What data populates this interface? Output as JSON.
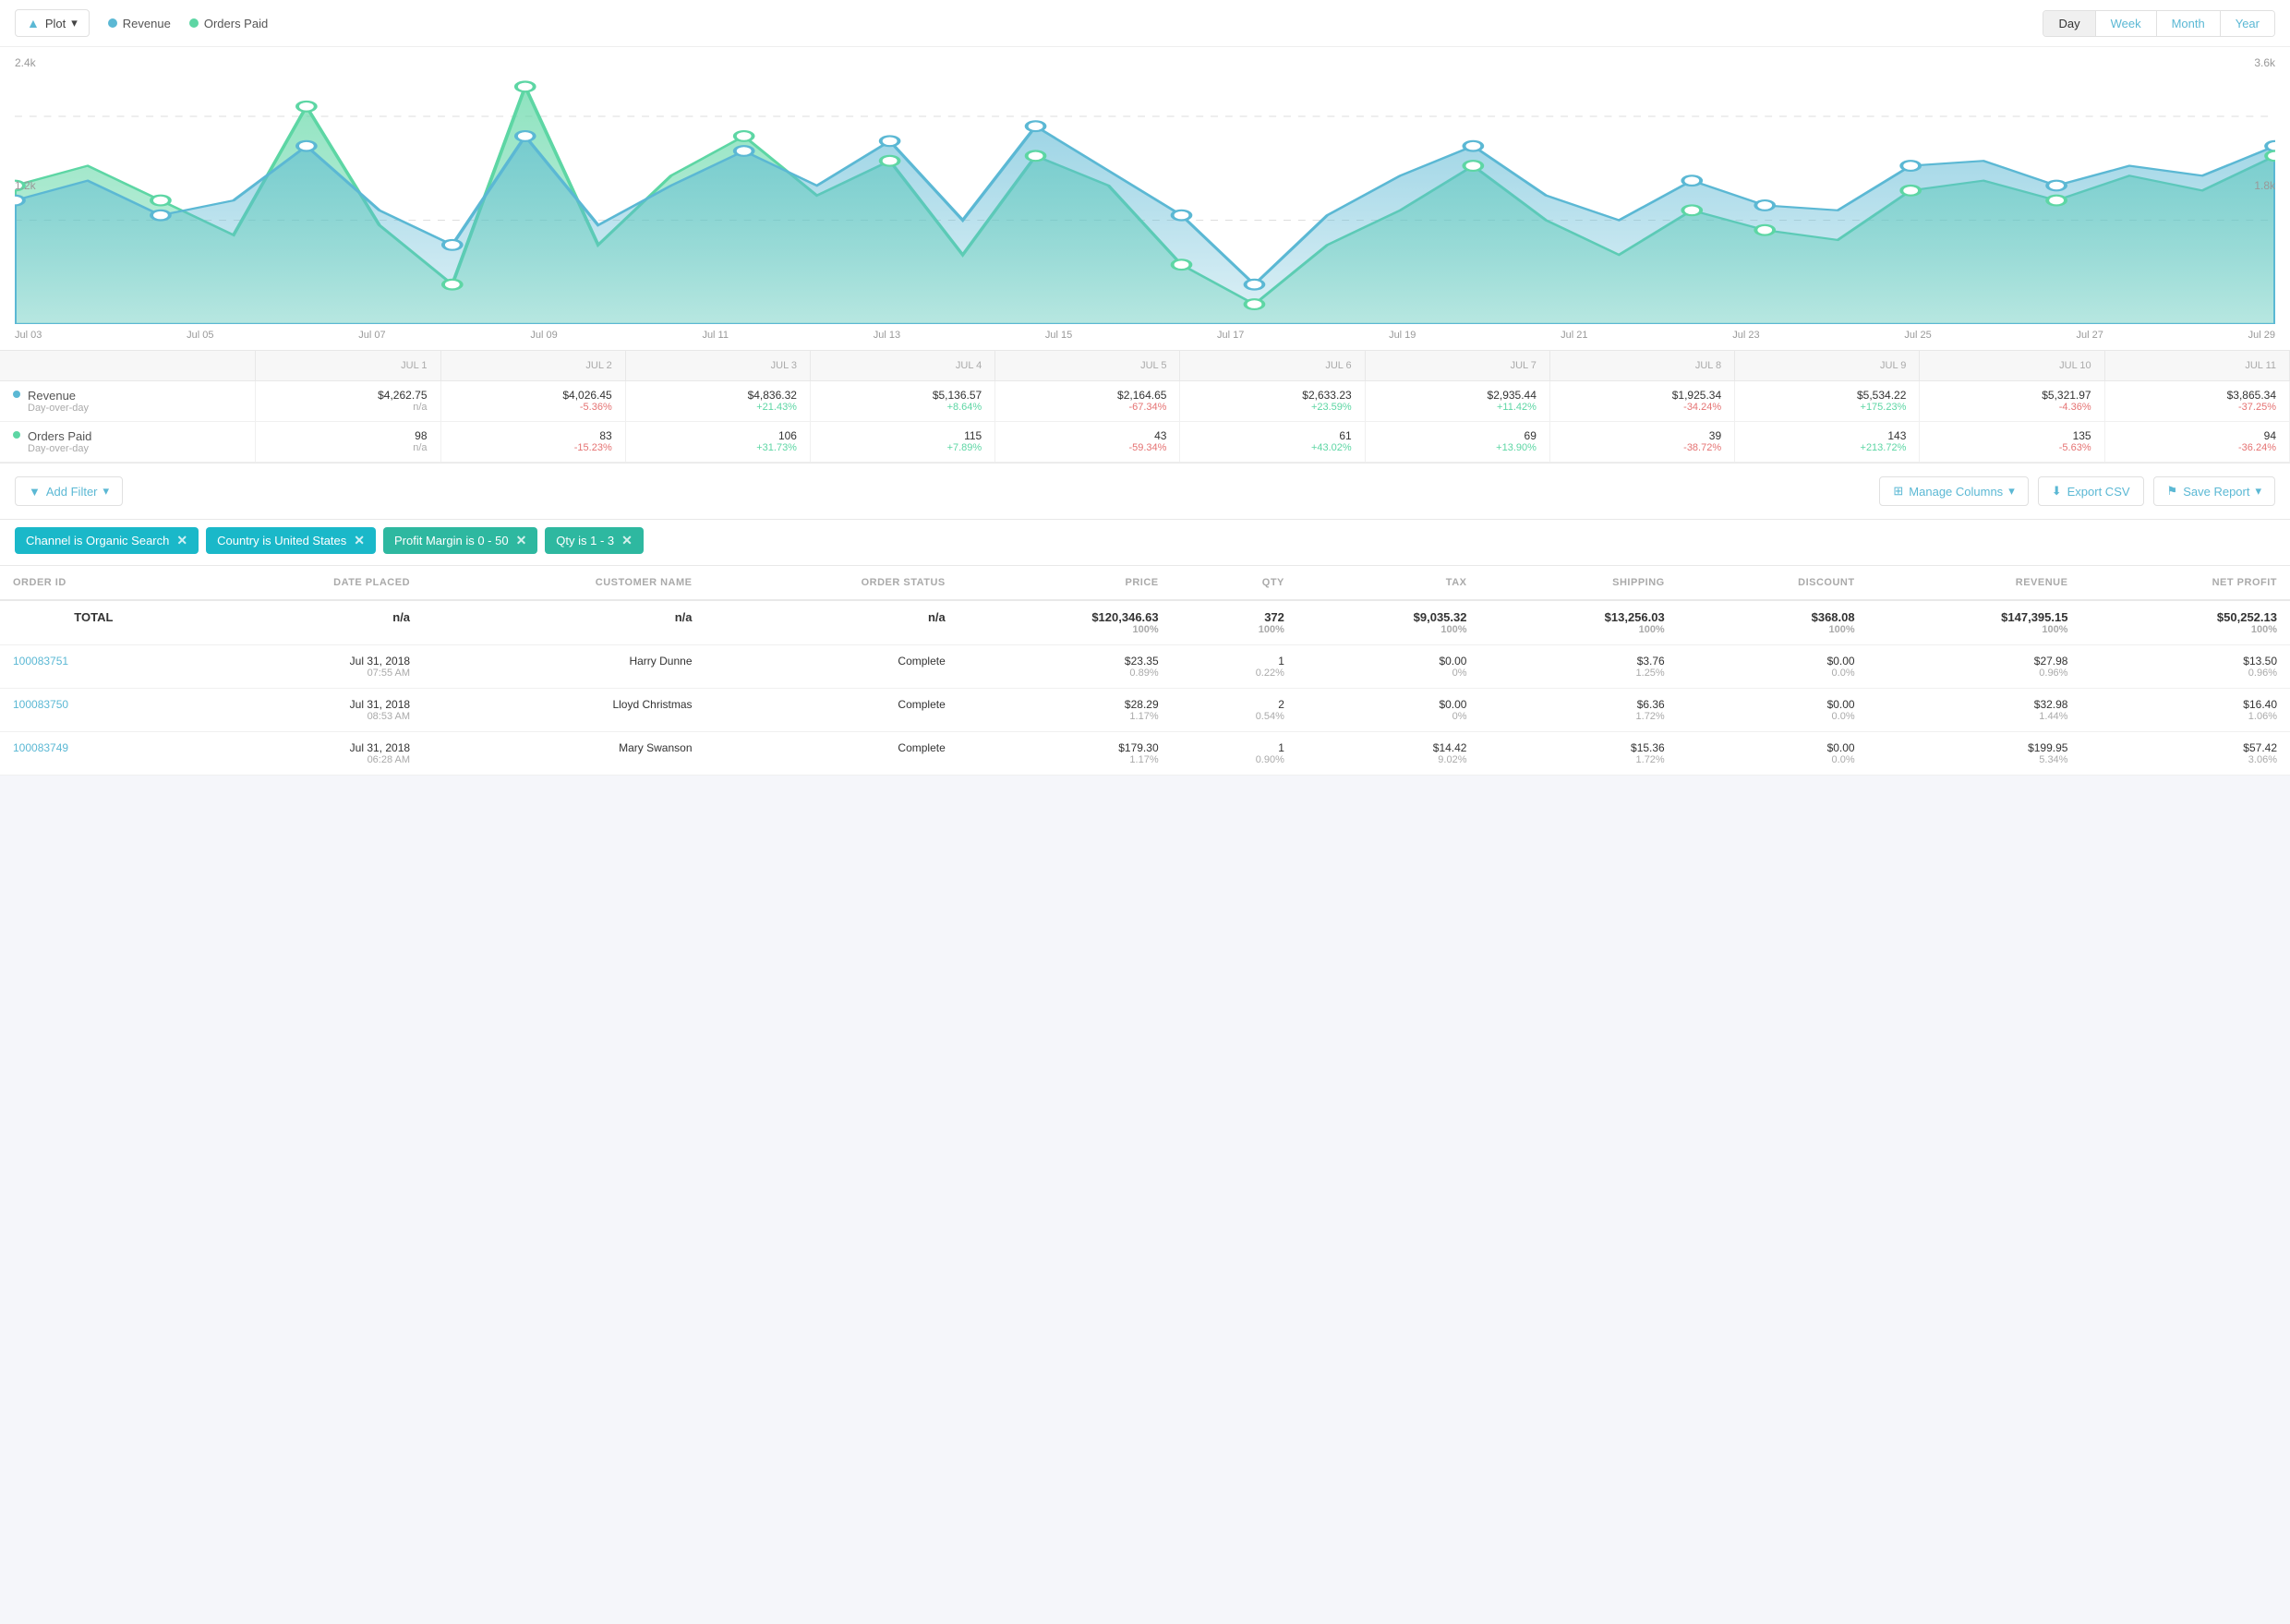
{
  "chart": {
    "legend": {
      "revenue_label": "Revenue",
      "orders_label": "Orders Paid"
    },
    "time_buttons": [
      "Day",
      "Week",
      "Month",
      "Year"
    ],
    "active_time": "Month",
    "y_left_top": "2.4k",
    "y_left_mid": "1.2k",
    "y_right_top": "3.6k",
    "y_right_mid": "1.8k",
    "x_labels": [
      "Jul 03",
      "Jul 05",
      "Jul 07",
      "Jul 09",
      "Jul 11",
      "Jul 13",
      "Jul 15",
      "Jul 17",
      "Jul 19",
      "Jul 21",
      "Jul 23",
      "Jul 25",
      "Jul 27",
      "Jul 29"
    ],
    "plot_btn": "Plot"
  },
  "metrics_table": {
    "columns": [
      "",
      "JUL 1",
      "JUL 2",
      "JUL 3",
      "JUL 4",
      "JUL 5",
      "JUL 6",
      "JUL 7",
      "JUL 8",
      "JUL 9",
      "JUL 10",
      "JUL 11"
    ],
    "revenue": {
      "label": "Revenue",
      "sub": "Day-over-day",
      "values": [
        "$4,262.75",
        "$4,026.45",
        "$4,836.32",
        "$5,136.57",
        "$2,164.65",
        "$2,633.23",
        "$2,935.44",
        "$1,925.34",
        "$5,534.22",
        "$5,321.97",
        "$3,865.34"
      ],
      "changes": [
        "n/a",
        "-5.36%",
        "+21.43%",
        "+8.64%",
        "-67.34%",
        "+23.59%",
        "+11.42%",
        "-34.24%",
        "+175.23%",
        "-4.36%",
        "-37.25%"
      ]
    },
    "orders": {
      "label": "Orders Paid",
      "sub": "Day-over-day",
      "values": [
        "98",
        "83",
        "106",
        "115",
        "43",
        "61",
        "69",
        "39",
        "143",
        "135",
        "94"
      ],
      "changes": [
        "n/a",
        "-15.23%",
        "+31.73%",
        "+7.89%",
        "-59.34%",
        "+43.02%",
        "+13.90%",
        "-38.72%",
        "+213.72%",
        "-5.63%",
        "-36.24%"
      ]
    }
  },
  "filters": {
    "add_filter_label": "Add Filter",
    "manage_cols_label": "Manage Columns",
    "export_label": "Export CSV",
    "save_report_label": "Save Report",
    "active_filters": [
      {
        "id": "channel",
        "label": "Channel is Organic Search",
        "color": "cyan"
      },
      {
        "id": "country",
        "label": "Country is United States",
        "color": "cyan"
      },
      {
        "id": "profit",
        "label": "Profit Margin is 0 - 50",
        "color": "teal"
      },
      {
        "id": "qty",
        "label": "Qty is 1 - 3",
        "color": "teal"
      }
    ]
  },
  "orders_table": {
    "columns": [
      "ORDER ID",
      "DATE PLACED",
      "CUSTOMER NAME",
      "ORDER STATUS",
      "PRICE",
      "QTY",
      "TAX",
      "SHIPPING",
      "DISCOUNT",
      "REVENUE",
      "NET PROFIT"
    ],
    "total_row": {
      "order_id": "TOTAL",
      "date": "n/a",
      "customer": "n/a",
      "status": "n/a",
      "price": "$120,346.63",
      "price_pct": "100%",
      "qty": "372",
      "qty_pct": "100%",
      "tax": "$9,035.32",
      "tax_pct": "100%",
      "shipping": "$13,256.03",
      "shipping_pct": "100%",
      "discount": "$368.08",
      "discount_pct": "100%",
      "revenue": "$147,395.15",
      "revenue_pct": "100%",
      "net_profit": "$50,252.13",
      "net_profit_pct": "100%"
    },
    "rows": [
      {
        "order_id": "100083751",
        "date": "Jul 31, 2018",
        "time": "07:55 AM",
        "customer": "Harry Dunne",
        "status": "Complete",
        "price": "$23.35",
        "price_pct": "0.89%",
        "qty": "1",
        "qty_pct": "0.22%",
        "tax": "$0.00",
        "tax_pct": "0%",
        "shipping": "$3.76",
        "shipping_pct": "1.25%",
        "discount": "$0.00",
        "discount_pct": "0.0%",
        "revenue": "$27.98",
        "revenue_pct": "0.96%",
        "net_profit": "$13.50",
        "net_profit_pct": "0.96%"
      },
      {
        "order_id": "100083750",
        "date": "Jul 31, 2018",
        "time": "08:53 AM",
        "customer": "Lloyd Christmas",
        "status": "Complete",
        "price": "$28.29",
        "price_pct": "1.17%",
        "qty": "2",
        "qty_pct": "0.54%",
        "tax": "$0.00",
        "tax_pct": "0%",
        "shipping": "$6.36",
        "shipping_pct": "1.72%",
        "discount": "$0.00",
        "discount_pct": "0.0%",
        "revenue": "$32.98",
        "revenue_pct": "1.44%",
        "net_profit": "$16.40",
        "net_profit_pct": "1.06%"
      },
      {
        "order_id": "100083749",
        "date": "Jul 31, 2018",
        "time": "06:28 AM",
        "customer": "Mary Swanson",
        "status": "Complete",
        "price": "$179.30",
        "price_pct": "1.17%",
        "qty": "1",
        "qty_pct": "0.90%",
        "tax": "$14.42",
        "tax_pct": "9.02%",
        "shipping": "$15.36",
        "shipping_pct": "1.72%",
        "discount": "$0.00",
        "discount_pct": "0.0%",
        "revenue": "$199.95",
        "revenue_pct": "5.34%",
        "net_profit": "$57.42",
        "net_profit_pct": "3.06%"
      }
    ]
  }
}
